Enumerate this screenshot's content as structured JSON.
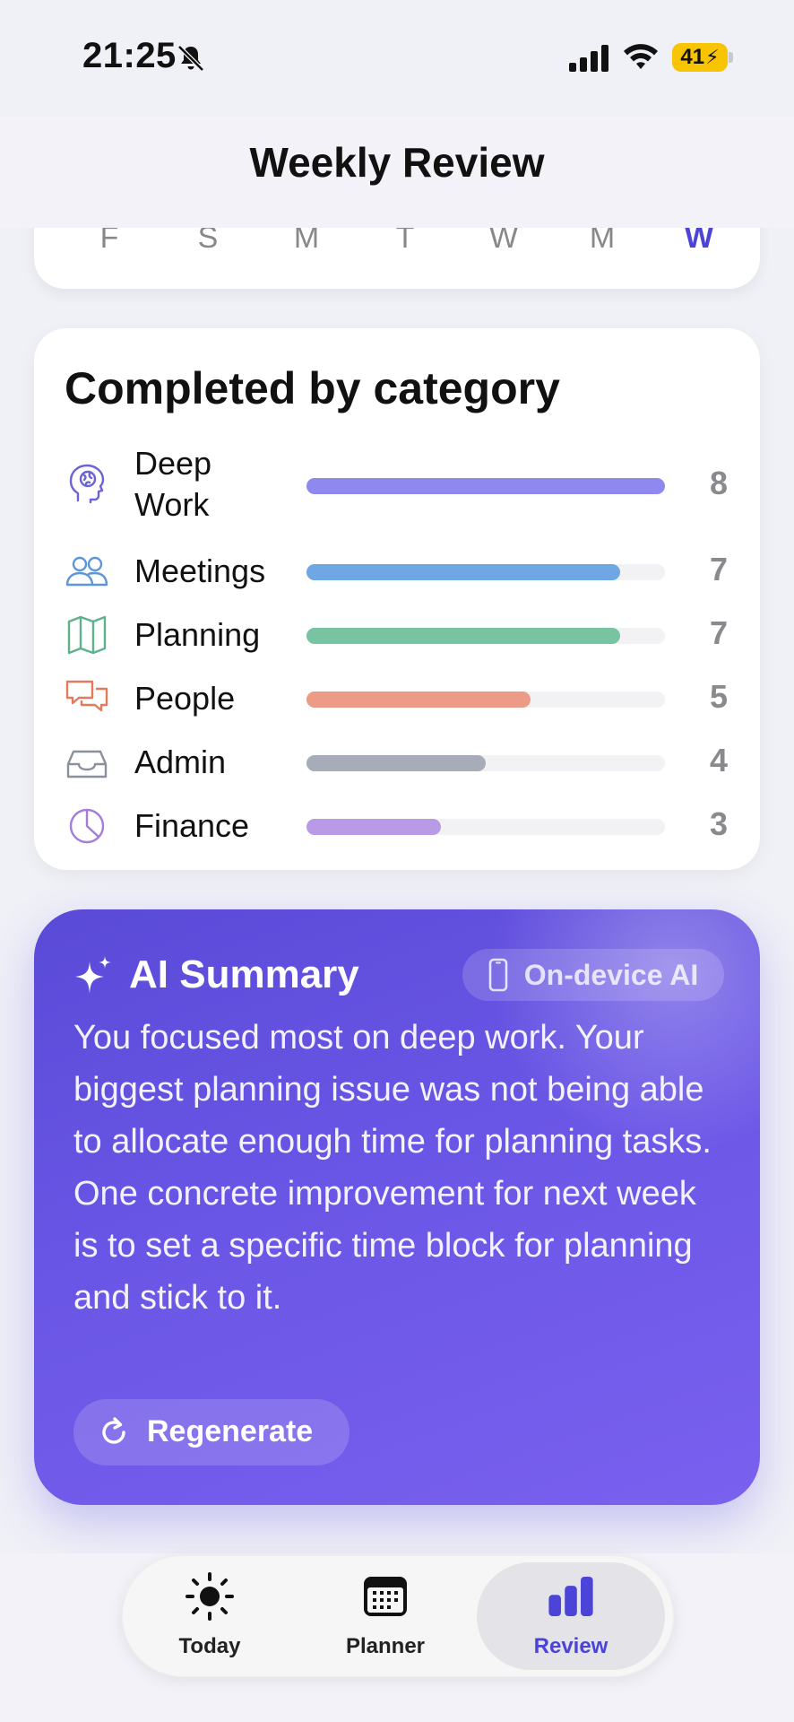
{
  "status_bar": {
    "time": "21:25",
    "battery": "41"
  },
  "header": {
    "title": "Weekly Review"
  },
  "week_strip": {
    "days": [
      "F",
      "S",
      "M",
      "T",
      "W",
      "M",
      "W"
    ],
    "selected_index": 6,
    "active_color": "#4b44d6"
  },
  "categories_card": {
    "title": "Completed by category",
    "max_value": 8,
    "items": [
      {
        "icon": "brain-icon",
        "label": "Deep Work",
        "label_line1": "Deep",
        "label_line2": "Work",
        "count": "8",
        "value": 8,
        "color": "#8f88ee"
      },
      {
        "icon": "people-icon",
        "label": "Meetings",
        "count": "7",
        "value": 7,
        "color": "#6fa6e4"
      },
      {
        "icon": "map-icon",
        "label": "Planning",
        "count": "7",
        "value": 7,
        "color": "#78c4a2"
      },
      {
        "icon": "chat-bubbles-icon",
        "label": "People",
        "count": "5",
        "value": 5,
        "color": "#ec9c86"
      },
      {
        "icon": "tray-icon",
        "label": "Admin",
        "count": "4",
        "value": 4,
        "color": "#a6acb8"
      },
      {
        "icon": "pie-chart-icon",
        "label": "Finance",
        "count": "3",
        "value": 3,
        "color": "#b89ae6"
      }
    ]
  },
  "ai_summary": {
    "title": "AI Summary",
    "badge": "On-device AI",
    "body": "You focused most on deep work. Your biggest planning issue was not being able to allocate enough time for planning tasks. One concrete improvement for next week is to set a specific time block for planning and stick to it.",
    "regenerate_label": "Regenerate"
  },
  "tab_bar": {
    "tabs": [
      {
        "label": "Today",
        "icon": "sun-icon"
      },
      {
        "label": "Planner",
        "icon": "calendar-icon"
      },
      {
        "label": "Review",
        "icon": "bar-chart-icon"
      }
    ],
    "selected": "Review"
  }
}
